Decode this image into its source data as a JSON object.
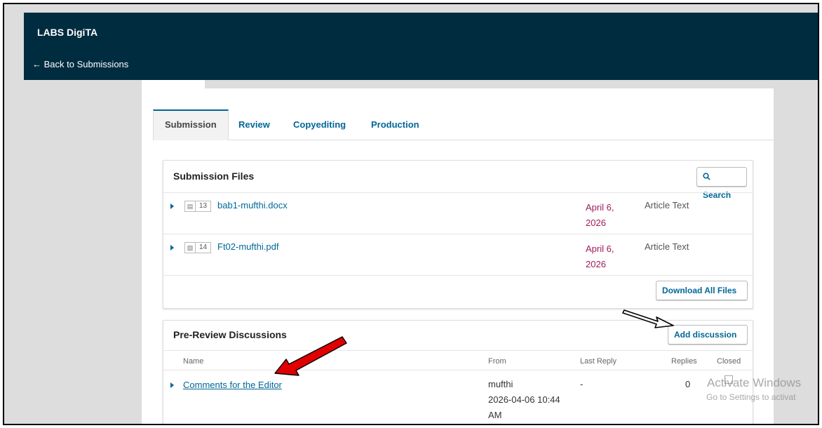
{
  "app": {
    "title": "LABS DigiTA",
    "back_link": "← Back to Submissions"
  },
  "tabs": [
    {
      "label": "Submission",
      "active": true
    },
    {
      "label": "Review",
      "active": false
    },
    {
      "label": "Copyediting",
      "active": false
    },
    {
      "label": "Production",
      "active": false
    }
  ],
  "submission_files": {
    "title": "Submission Files",
    "search_label": "Search",
    "download_all_label": "Download All Files",
    "files": [
      {
        "id": "13",
        "name": "bab1-mufthi.docx",
        "date_line1": "April 6,",
        "date_line2": "2026",
        "type": "Article Text"
      },
      {
        "id": "14",
        "name": "Ft02-mufthi.pdf",
        "date_line1": "April 6,",
        "date_line2": "2026",
        "type": "Article Text"
      }
    ]
  },
  "discussions": {
    "title": "Pre-Review Discussions",
    "add_label": "Add discussion",
    "columns": {
      "name": "Name",
      "from": "From",
      "last_reply": "Last Reply",
      "replies": "Replies",
      "closed": "Closed"
    },
    "rows": [
      {
        "name": "Comments for the Editor",
        "from_user": "mufthi",
        "from_date_line1": "2026-04-06 10:44",
        "from_date_line2": "AM",
        "last_reply": "-",
        "replies": "0",
        "closed": false
      }
    ]
  },
  "watermark": {
    "line1": "Activate Windows",
    "line2": "Go to Settings to activat"
  },
  "colors": {
    "header": "#002c40",
    "link": "#006798",
    "date": "#a01a5a",
    "annotation_arrow": "#e00000"
  },
  "icons": {
    "search": "search-icon",
    "docx": "doc-file-icon",
    "pdf": "pdf-file-icon"
  }
}
